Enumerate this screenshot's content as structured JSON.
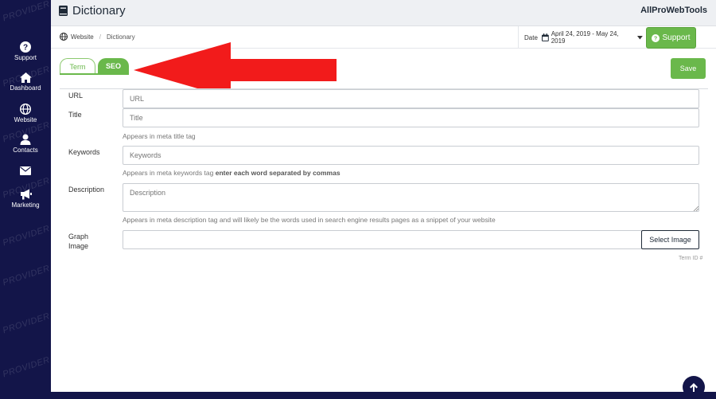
{
  "sidebar": {
    "watermark": "PROVIDER",
    "items": [
      {
        "label": "Support",
        "icon": "question-circle-icon"
      },
      {
        "label": "Dashboard",
        "icon": "home-icon"
      },
      {
        "label": "Website",
        "icon": "globe-icon"
      },
      {
        "label": "Contacts",
        "icon": "user-icon"
      },
      {
        "label": "",
        "icon": "envelope-icon"
      },
      {
        "label": "Marketing",
        "icon": "megaphone-icon"
      }
    ]
  },
  "header": {
    "title": "Dictionary",
    "brand": "AllProWebTools",
    "icon": "book-icon"
  },
  "breadcrumb": {
    "items": [
      "Website",
      "Dictionary"
    ]
  },
  "date_filter": {
    "label": "Date",
    "range": "April 24, 2019 - May 24, 2019"
  },
  "support_button": {
    "label": "Support"
  },
  "tabs": [
    {
      "label": "Term",
      "active": false
    },
    {
      "label": "SEO",
      "active": true
    }
  ],
  "save_button": {
    "label": "Save"
  },
  "form": {
    "url": {
      "label": "URL",
      "placeholder": "URL"
    },
    "title": {
      "label": "Title",
      "placeholder": "Title",
      "hint": "Appears in meta title tag"
    },
    "keywords": {
      "label": "Keywords",
      "placeholder": "Keywords",
      "hint": "Appears in meta keywords tag",
      "hint_bold": "enter each word separated by commas"
    },
    "description": {
      "label": "Description",
      "placeholder": "Description",
      "hint": "Appears in meta description tag and will likely be the words used in search engine results pages as a snippet of your website"
    },
    "graph_image": {
      "label_line1": "Graph",
      "label_line2": "Image",
      "button": "Select Image"
    },
    "term_id": "Term ID #"
  },
  "colors": {
    "sidebar_bg": "#131549",
    "accent_green": "#6ab84b",
    "arrow_red": "#f21b1b"
  }
}
